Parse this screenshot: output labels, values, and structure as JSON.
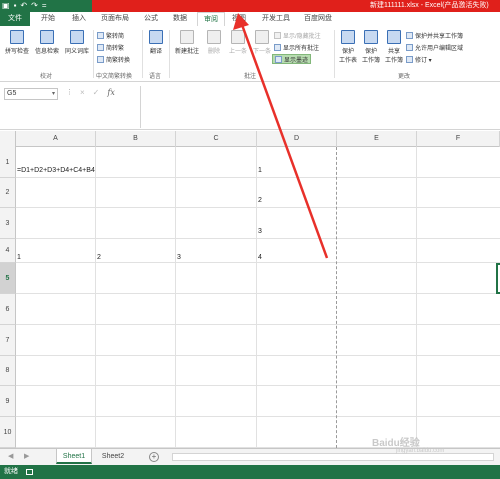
{
  "qat": {
    "save_icon": "save-icon",
    "undo_icon": "undo-icon",
    "redo_icon": "redo-icon",
    "more": "="
  },
  "window_title": "新建111111.xlsx - Excel(产品激活失败)",
  "tabs": [
    {
      "label": "文件"
    },
    {
      "label": "开始"
    },
    {
      "label": "插入"
    },
    {
      "label": "页面布局"
    },
    {
      "label": "公式"
    },
    {
      "label": "数据"
    },
    {
      "label": "审阅"
    },
    {
      "label": "视图"
    },
    {
      "label": "开发工具"
    },
    {
      "label": "百度网盘"
    }
  ],
  "ribbon": {
    "proofing": {
      "spell": "拼写检查",
      "research": "信息检索",
      "thesaurus": "同义词库",
      "label": "校对"
    },
    "chinese": {
      "to_trad": "繁转简",
      "to_simp": "简转繁",
      "convert": "简繁转换",
      "label": "中文简繁转换"
    },
    "language": {
      "translate": "翻译",
      "label": "语言"
    },
    "comments": {
      "new": "新建批注",
      "delete": "删除",
      "prev": "上一条",
      "next": "下一条",
      "show_hide": "显示/隐藏批注",
      "show_all": "显示所有批注",
      "show_ink": "显示墨迹",
      "label": "批注"
    },
    "changes": {
      "protect_sheet": "保护\n工作表",
      "protect_book": "保护\n工作簿",
      "share_book": "共享\n工作簿",
      "protect_share": "保护并共享工作簿",
      "allow_edit": "允许用户编辑区域",
      "track": "修订 ▾",
      "label": "更改"
    }
  },
  "formula_bar": {
    "name_box": "G5",
    "cancel": "×",
    "enter": "✓",
    "fx": "fx",
    "formula": ""
  },
  "columns": [
    "A",
    "B",
    "C",
    "D",
    "E",
    "F"
  ],
  "rows": [
    "1",
    "2",
    "3",
    "4",
    "5",
    "6",
    "7",
    "8",
    "9",
    "10"
  ],
  "cells": {
    "A1": "=D1+D2+D3+D4+C4+B4",
    "D1": "1",
    "D2": "2",
    "D3": "3",
    "A4": "1",
    "B4": "2",
    "C4": "3",
    "D4": "4"
  },
  "sheets": [
    {
      "label": "Sheet1",
      "active": true
    },
    {
      "label": "Sheet2",
      "active": false
    }
  ],
  "add_sheet": "⊕",
  "status": {
    "ready": "就绪"
  },
  "watermark": {
    "text": "Baidu经验",
    "sub": "jingyan.baidu.com"
  },
  "colors": {
    "excel_green": "#217346",
    "title_red": "#e0201b",
    "arrow_red": "#e8302a"
  }
}
